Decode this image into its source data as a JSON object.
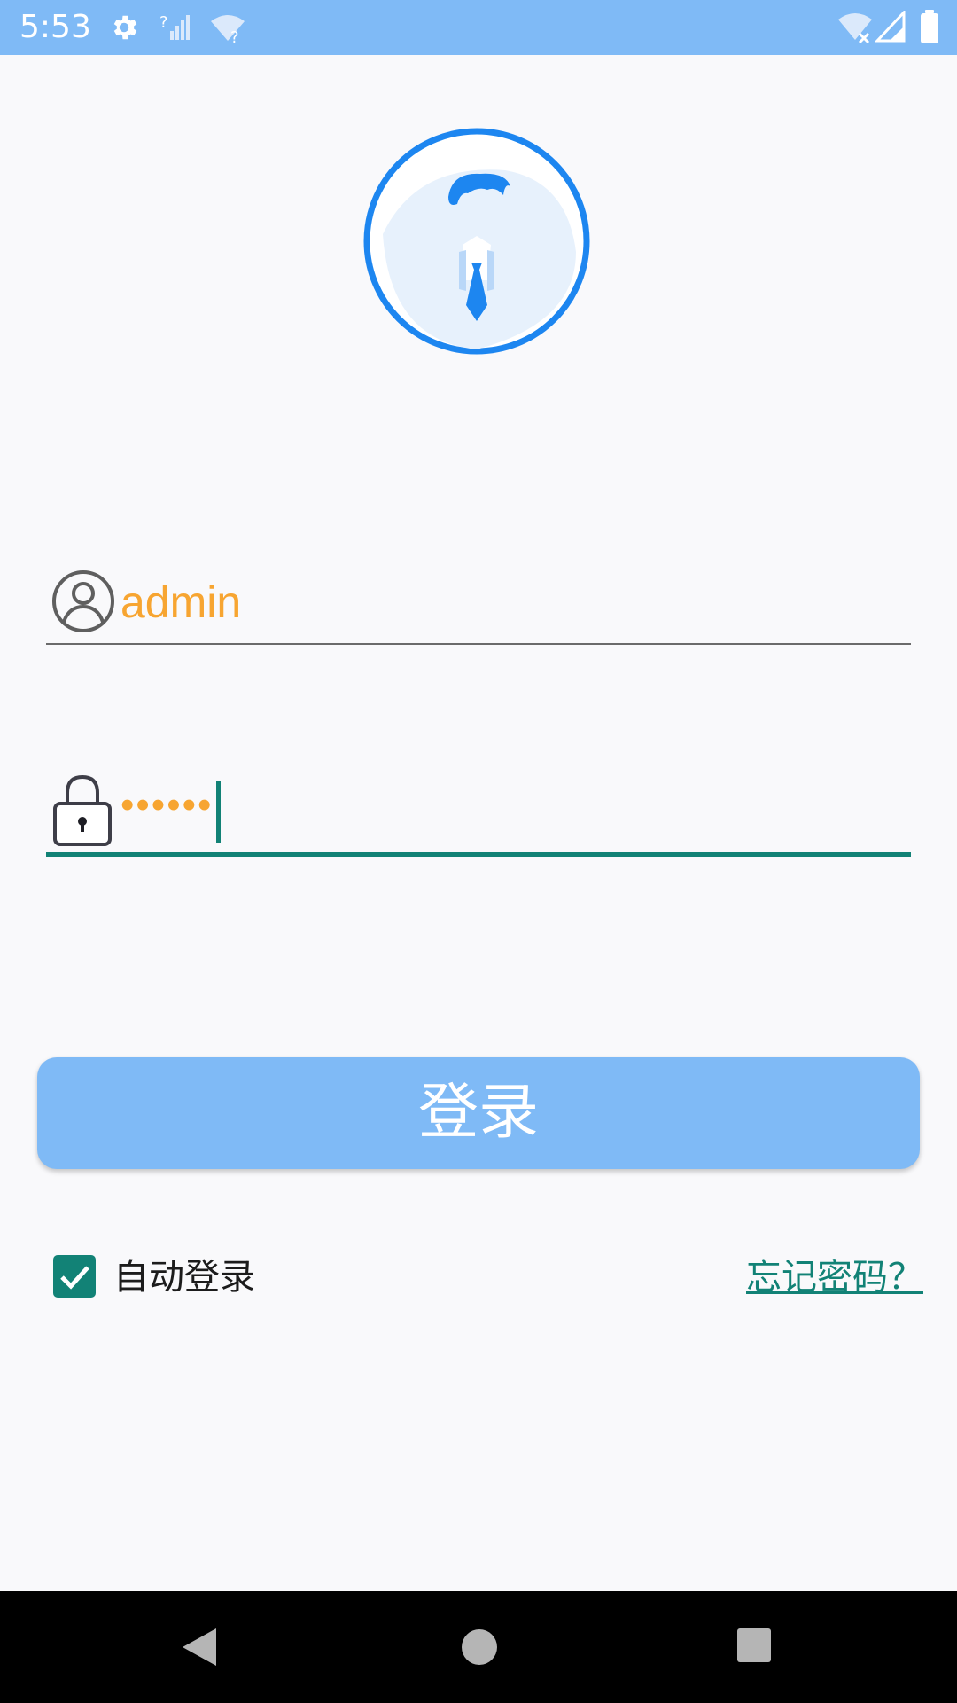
{
  "status_bar": {
    "time": "5:53",
    "icons": [
      "gear-icon",
      "signal-unknown-icon",
      "wifi-unknown-icon",
      "wifi-off-icon",
      "cell-signal-icon",
      "battery-icon"
    ],
    "background": "#7fbaf6"
  },
  "avatar": {
    "icon": "user-avatar-icon",
    "ring_color": "#1d86f0"
  },
  "username": {
    "icon": "user-icon",
    "value": "admin",
    "text_color": "#f7a531"
  },
  "password": {
    "icon": "lock-icon",
    "value": "••••••",
    "focused": true,
    "accent_color": "#128276"
  },
  "login_button": {
    "label": "登录",
    "background": "#7fbaf6"
  },
  "auto_login": {
    "label": "自动登录",
    "checked": true
  },
  "forgot_password": {
    "label": "忘记密码？"
  },
  "nav_bar": {
    "icons": [
      "back-icon",
      "home-icon",
      "recents-icon"
    ]
  }
}
